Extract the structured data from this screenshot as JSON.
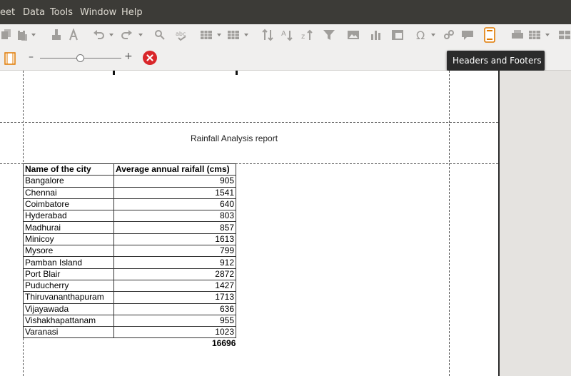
{
  "menu": {
    "items": [
      "eet",
      "Data",
      "Tools",
      "Window",
      "Help"
    ]
  },
  "toolbar": {
    "highlighted_button": "headers-and-footers",
    "zoom_minus": "–",
    "zoom_plus": "+"
  },
  "tooltip": {
    "text": "Headers and Footers"
  },
  "document": {
    "title": "Rainfall Analysis report",
    "table": {
      "headers": [
        "Name of the city",
        "Average annual raifall (cms)"
      ],
      "rows": [
        [
          "Bangalore",
          "905"
        ],
        [
          "Chennai",
          "1541"
        ],
        [
          "Coimbatore",
          "640"
        ],
        [
          "Hyderabad",
          "803"
        ],
        [
          "Madhurai",
          "857"
        ],
        [
          "Minicoy",
          "1613"
        ],
        [
          "Mysore",
          "799"
        ],
        [
          "Pamban Island",
          "912"
        ],
        [
          "Port Blair",
          "2872"
        ],
        [
          "Puducherry",
          "1427"
        ],
        [
          "Thiruvananthapuram",
          "1713"
        ],
        [
          "Vijayawada",
          "636"
        ],
        [
          "Vishakhapattanam",
          "955"
        ],
        [
          "Varanasi",
          "1023"
        ]
      ],
      "total": "16696"
    }
  },
  "colors": {
    "menubar_bg": "#3c3b37",
    "highlight": "#e01b1b",
    "close_red": "#d9262a"
  }
}
